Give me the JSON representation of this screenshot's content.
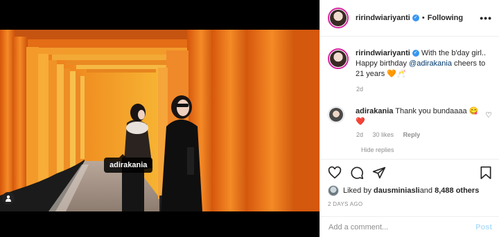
{
  "post": {
    "username": "ririndwiariyanti",
    "verified": true,
    "follow_state": "Following",
    "dot": "•",
    "more": "•••"
  },
  "media": {
    "tag_label": "adirakania",
    "user_tag_icon": "person-icon"
  },
  "caption": {
    "username": "ririndwiariyanti",
    "text_before": "With the b'day girl.. Happy birthday ",
    "mention": "@adirakania",
    "text_after": " cheers to 21 years 🧡🥂",
    "time": "2d"
  },
  "comment": {
    "username": "adirakania",
    "text": "Thank you bundaaaa 😋❤️",
    "time": "2d",
    "likes": "30 likes",
    "reply": "Reply",
    "hide_replies": "Hide replies"
  },
  "actions": {
    "icons": [
      "heart-icon",
      "comment-icon",
      "share-icon",
      "bookmark-icon"
    ],
    "liked_by_prefix": "Liked by ",
    "liked_by_user": "dausminiasli",
    "liked_by_and": " and ",
    "liked_by_count": "8,488 others",
    "post_time": "2 DAYS AGO"
  },
  "add_comment": {
    "placeholder": "Add a comment...",
    "post_label": "Post"
  },
  "colors": {
    "accent": "#3897f0",
    "post_disabled": "#b2dffc",
    "torii_orange": "#f07a1e"
  }
}
